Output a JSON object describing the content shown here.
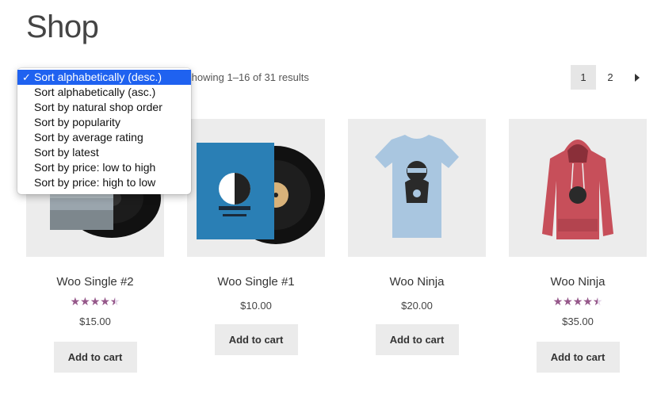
{
  "page": {
    "title": "Shop"
  },
  "results": {
    "text": "Showing 1–16 of 31 results"
  },
  "pagination": {
    "pages": [
      "1",
      "2"
    ],
    "current": "1",
    "next_icon": "arrow-right-icon"
  },
  "sort": {
    "options": [
      "Sort alphabetically (desc.)",
      "Sort alphabetically (asc.)",
      "Sort by natural shop order",
      "Sort by popularity",
      "Sort by average rating",
      "Sort by latest",
      "Sort by price: low to high",
      "Sort by price: high to low"
    ],
    "selected_index": 0,
    "check": "✓"
  },
  "products": [
    {
      "title": "Woo Single #2",
      "price": "$15.00",
      "rating": 4.5,
      "button": "Add to cart",
      "image": "vinyl-record"
    },
    {
      "title": "Woo Single #1",
      "price": "$10.00",
      "rating": null,
      "button": "Add to cart",
      "image": "vinyl-record-woothemes"
    },
    {
      "title": "Woo Ninja",
      "price": "$20.00",
      "rating": null,
      "button": "Add to cart",
      "image": "tshirt"
    },
    {
      "title": "Woo Ninja",
      "price": "$35.00",
      "rating": 4.5,
      "button": "Add to cart",
      "image": "hoodie"
    }
  ],
  "colors": {
    "accent": "#96588a",
    "selection": "#1f62f0",
    "image_bg": "#ececec",
    "button_bg": "#ebebeb"
  }
}
